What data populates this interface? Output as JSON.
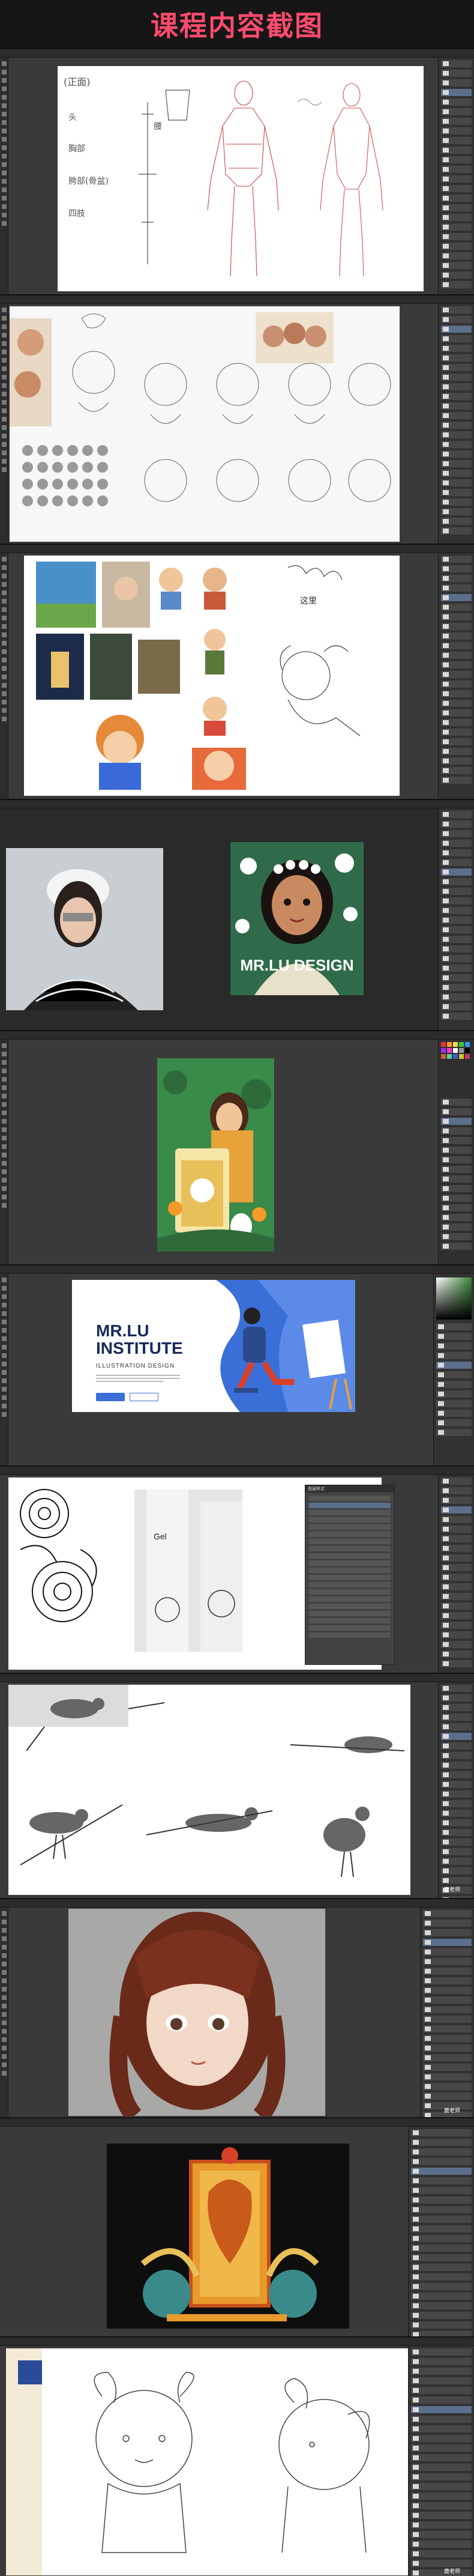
{
  "header": {
    "title": "课程内容截图"
  },
  "screens": {
    "s1": {
      "doc_title": "",
      "sketch_notes": [
        "(正面)",
        "头",
        "胸部",
        "胯部(骨盆)",
        "四肢",
        "腰"
      ]
    },
    "s2": {
      "doc_title": ""
    },
    "s3": {
      "doc_title": "",
      "sketch_note": "这里"
    },
    "s4": {
      "doc_title": "",
      "poster_text": "MR.LU DESIGN"
    },
    "s5": {
      "doc_title": ""
    },
    "s6": {
      "doc_title": "",
      "web_title": "MR.LU INSTITUTE",
      "web_subtitle": "ILLUSTRATION DESIGN",
      "btn_primary": "",
      "btn_secondary": ""
    },
    "s7": {
      "doc_title": "",
      "box_label": "Gel",
      "dialog_title": "图层样式"
    },
    "s8": {
      "doc_title": "",
      "watermark": "鹿老师"
    },
    "s9": {
      "doc_title": "",
      "watermark": "鹿老师"
    },
    "s10": {
      "doc_title": ""
    },
    "s11": {
      "doc_title": "",
      "watermark": "鹿老师"
    }
  },
  "colors": {
    "title": "#ff4b6e",
    "ps_bg": "#3a3a3a",
    "panel": "#323232"
  }
}
